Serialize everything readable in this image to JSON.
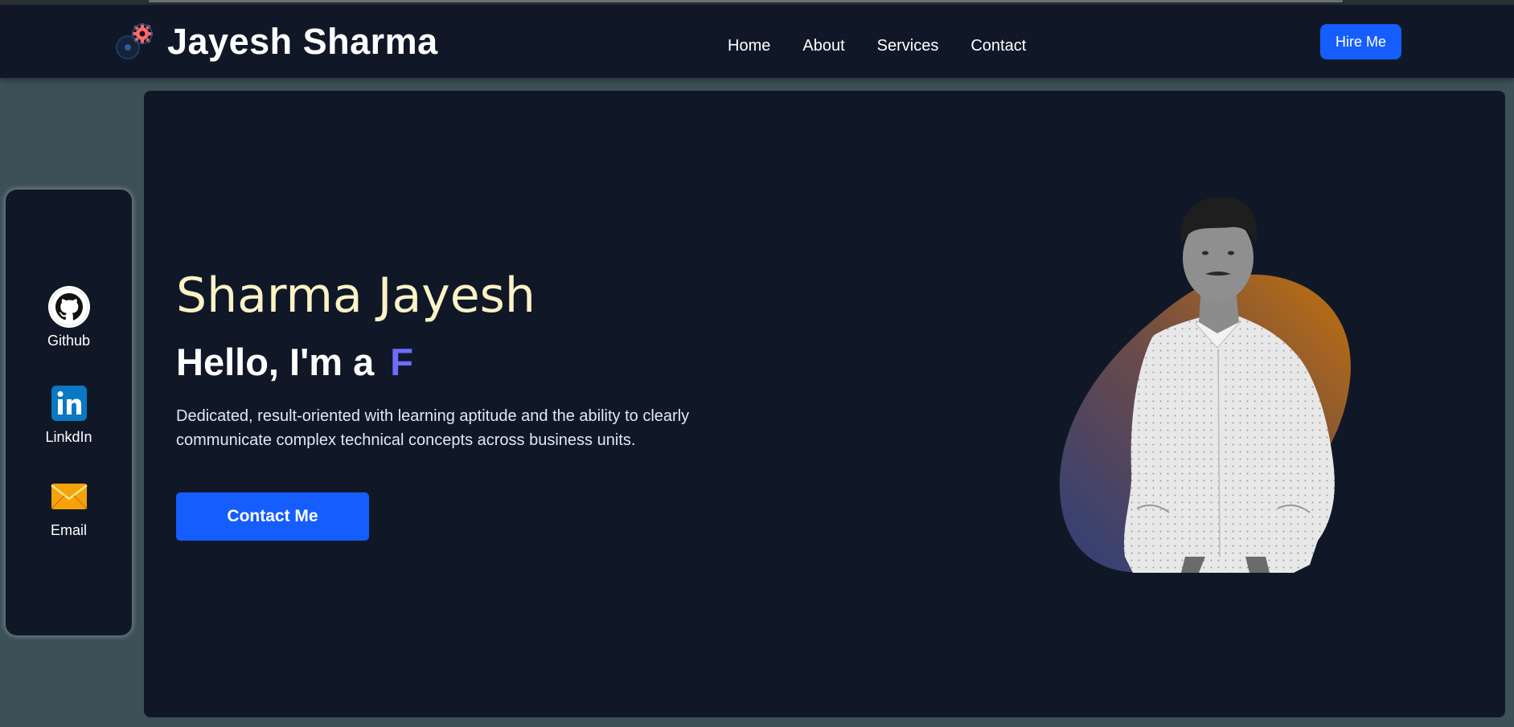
{
  "brand": {
    "name": "Jayesh Sharma",
    "logo_icon": "gears-icon"
  },
  "nav": {
    "links": [
      "Home",
      "About",
      "Services",
      "Contact"
    ],
    "hire_label": "Hire Me"
  },
  "social": [
    {
      "label": "Github",
      "icon": "github-icon"
    },
    {
      "label": "LinkdIn",
      "icon": "linkedin-icon"
    },
    {
      "label": "Email",
      "icon": "envelope-icon"
    }
  ],
  "hero": {
    "name": "Sharma Jayesh",
    "greeting": "Hello, I'm a",
    "typed": "F",
    "description": "Dedicated, result-oriented with learning aptitude and the ability to clearly communicate complex technical concepts across business units.",
    "cta_label": "Contact Me"
  },
  "colors": {
    "background": "#3d4f57",
    "panel": "#101828",
    "accent": "#155dfc",
    "name_color": "#fef3c6",
    "typed_color": "#6d6dff",
    "blob_orange": "#c2710c",
    "blob_blue": "#2e3f7a"
  }
}
